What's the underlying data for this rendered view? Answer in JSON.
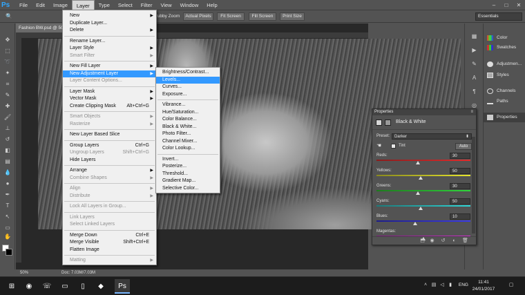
{
  "menubar": {
    "logo": "Ps",
    "items": [
      "File",
      "Edit",
      "Image",
      "Layer",
      "Type",
      "Select",
      "Filter",
      "View",
      "Window",
      "Help"
    ],
    "active": "Layer",
    "window_controls": [
      "–",
      "□",
      "✕"
    ]
  },
  "optionsbar": {
    "scrubby_zoom": "Scrubby Zoom",
    "actual_pixels": "Actual Pixels",
    "fit_screen": "Fit Screen",
    "fill_screen": "Fill Screen",
    "print_size": "Print Size",
    "workspace": "Essentials"
  },
  "document": {
    "tab_title": "Fashion BW.psd @ 50",
    "zoom": "50%",
    "doc_info": "Doc: 7.03M/7.03M"
  },
  "layer_menu": {
    "items": [
      {
        "label": "New",
        "submenu": true,
        "disabled": false
      },
      {
        "label": "Duplicate Layer...",
        "disabled": false
      },
      {
        "label": "Delete",
        "submenu": true,
        "disabled": false
      },
      {
        "label": "Rename Layer...",
        "disabled": false
      },
      {
        "label": "Layer Style",
        "submenu": true,
        "disabled": false
      },
      {
        "label": "Smart Filter",
        "submenu": true,
        "disabled": true
      },
      {
        "label": "New Fill Layer",
        "submenu": true,
        "disabled": false
      },
      {
        "label": "New Adjustment Layer",
        "submenu": true,
        "disabled": false,
        "highlighted": true
      },
      {
        "label": "Layer Content Options...",
        "disabled": true
      },
      {
        "label": "Layer Mask",
        "submenu": true,
        "disabled": false
      },
      {
        "label": "Vector Mask",
        "submenu": true,
        "disabled": false
      },
      {
        "label": "Create Clipping Mask",
        "shortcut": "Alt+Ctrl+G",
        "disabled": false
      },
      {
        "label": "Smart Objects",
        "submenu": true,
        "disabled": true
      },
      {
        "label": "Rasterize",
        "submenu": true,
        "disabled": true
      },
      {
        "label": "New Layer Based Slice",
        "disabled": false
      },
      {
        "label": "Group Layers",
        "shortcut": "Ctrl+G",
        "disabled": false
      },
      {
        "label": "Ungroup Layers",
        "shortcut": "Shift+Ctrl+G",
        "disabled": true
      },
      {
        "label": "Hide Layers",
        "disabled": false
      },
      {
        "label": "Arrange",
        "submenu": true,
        "disabled": false
      },
      {
        "label": "Combine Shapes",
        "submenu": true,
        "disabled": true
      },
      {
        "label": "Align",
        "submenu": true,
        "disabled": true
      },
      {
        "label": "Distribute",
        "submenu": true,
        "disabled": true
      },
      {
        "label": "Lock All Layers in Group...",
        "disabled": true
      },
      {
        "label": "Link Layers",
        "disabled": true
      },
      {
        "label": "Select Linked Layers",
        "disabled": true
      },
      {
        "label": "Merge Down",
        "shortcut": "Ctrl+E",
        "disabled": false
      },
      {
        "label": "Merge Visible",
        "shortcut": "Shift+Ctrl+E",
        "disabled": false
      },
      {
        "label": "Flatten Image",
        "disabled": false
      },
      {
        "label": "Matting",
        "submenu": true,
        "disabled": true
      }
    ]
  },
  "adjustment_submenu": {
    "items": [
      {
        "label": "Brightness/Contrast..."
      },
      {
        "label": "Levels...",
        "highlighted": true
      },
      {
        "label": "Curves..."
      },
      {
        "label": "Exposure..."
      },
      {
        "label": "Vibrance..."
      },
      {
        "label": "Hue/Saturation..."
      },
      {
        "label": "Color Balance..."
      },
      {
        "label": "Black & White..."
      },
      {
        "label": "Photo Filter..."
      },
      {
        "label": "Channel Mixer..."
      },
      {
        "label": "Color Lookup..."
      },
      {
        "label": "Invert..."
      },
      {
        "label": "Posterize..."
      },
      {
        "label": "Threshold..."
      },
      {
        "label": "Gradient Map..."
      },
      {
        "label": "Selective Color..."
      }
    ]
  },
  "right_panels": {
    "items": [
      "Color",
      "Swatches",
      "Adjustmen...",
      "Styles",
      "Channels",
      "Paths",
      "Properties"
    ],
    "active": "Properties"
  },
  "properties": {
    "tab": "Properties",
    "type_label": "Black & White",
    "preset_label": "Preset:",
    "preset_value": "Darker",
    "tint_label": "Tint",
    "auto_label": "Auto",
    "sliders": [
      {
        "label": "Reds:",
        "value": "30",
        "color_left": "#8a1d1d",
        "color_right": "#e32b2b",
        "pct": 0.44
      },
      {
        "label": "Yellows:",
        "value": "50",
        "color_left": "#8a8a1d",
        "color_right": "#e8e62c",
        "pct": 0.47
      },
      {
        "label": "Greens:",
        "value": "30",
        "color_left": "#1d7a1d",
        "color_right": "#2ed63a",
        "pct": 0.44
      },
      {
        "label": "Cyans:",
        "value": "50",
        "color_left": "#1d7a7a",
        "color_right": "#2ed6d6",
        "pct": 0.47
      },
      {
        "label": "Blues:",
        "value": "10",
        "color_left": "#1d1d8a",
        "color_right": "#3a3ae8",
        "pct": 0.41
      },
      {
        "label": "Magentas:",
        "value": "",
        "color_left": "#7a1d7a",
        "color_right": "#d62ed6",
        "pct": 0.5
      }
    ]
  },
  "taskbar": {
    "time": "11:41",
    "date": "24/01/2017",
    "language": "ENG"
  }
}
